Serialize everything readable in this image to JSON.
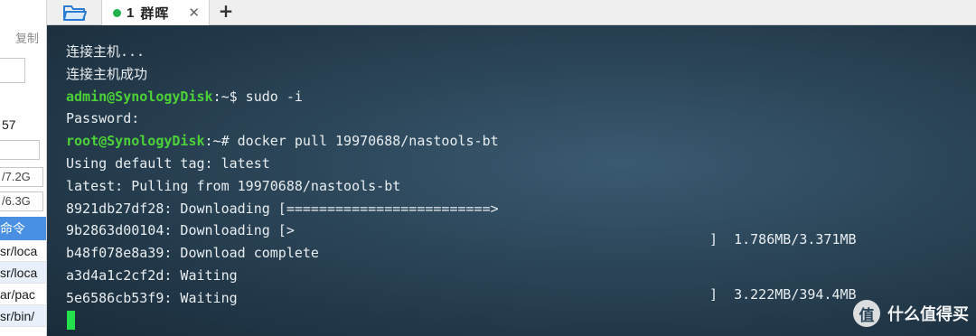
{
  "left_panel": {
    "copy_label": "复制",
    "fragment_57": "57",
    "field1": "/7.2G",
    "field2": "/6.3G",
    "list_header": "命令",
    "rows": [
      "sr/loca",
      "sr/loca",
      "ar/pac",
      "sr/bin/"
    ]
  },
  "tabbar": {
    "tab_index": "1",
    "tab_name": "群晖",
    "close": "✕",
    "add": "+"
  },
  "terminal": {
    "lines": [
      {
        "parts": [
          {
            "t": "连接主机...",
            "c": ""
          }
        ]
      },
      {
        "parts": [
          {
            "t": "连接主机成功",
            "c": ""
          }
        ]
      },
      {
        "parts": [
          {
            "t": "admin@SynologyDisk",
            "c": "green"
          },
          {
            "t": ":~$ sudo -i",
            "c": ""
          }
        ]
      },
      {
        "parts": [
          {
            "t": "Password:",
            "c": ""
          }
        ]
      },
      {
        "parts": [
          {
            "t": "root@SynologyDisk",
            "c": "green"
          },
          {
            "t": ":~# docker pull 19970688/nastools-bt",
            "c": ""
          }
        ]
      },
      {
        "parts": [
          {
            "t": "Using default tag: latest",
            "c": ""
          }
        ]
      },
      {
        "parts": [
          {
            "t": "latest: Pulling from 19970688/nastools-bt",
            "c": ""
          }
        ]
      },
      {
        "parts": [
          {
            "t": "8921db27df28: Downloading [=========================>",
            "c": ""
          }
        ]
      },
      {
        "parts": [
          {
            "t": "9b2863d00104: Downloading [>",
            "c": ""
          }
        ]
      },
      {
        "parts": [
          {
            "t": "b48f078e8a39: Download complete",
            "c": ""
          }
        ]
      },
      {
        "parts": [
          {
            "t": "a3d4a1c2cf2d: Waiting",
            "c": ""
          }
        ]
      },
      {
        "parts": [
          {
            "t": "5e6586cb53f9: Waiting",
            "c": ""
          }
        ]
      }
    ],
    "progress_right": [
      "]  1.786MB/3.371MB",
      "]  3.222MB/394.4MB"
    ]
  },
  "watermark": {
    "logo": "值",
    "text": "什么值得买"
  },
  "colors": {
    "prompt_green": "#4cd137",
    "cursor_green": "#22e14a",
    "terminal_bg": "#2c4659",
    "selected_blue": "#4a90e2"
  }
}
